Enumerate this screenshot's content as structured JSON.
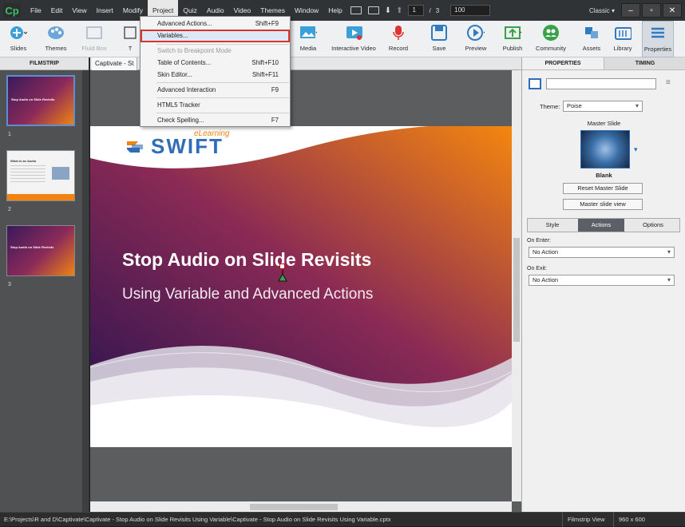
{
  "app": {
    "logo": "Cp",
    "workspace": "Classic"
  },
  "menubar": {
    "items": [
      "File",
      "Edit",
      "View",
      "Insert",
      "Modify",
      "Project",
      "Quiz",
      "Audio",
      "Video",
      "Themes",
      "Window",
      "Help"
    ],
    "active": "Project",
    "page_current": "1",
    "page_sep": "/",
    "page_total": "3",
    "zoom": "100"
  },
  "toolbar": {
    "buttons": [
      {
        "label": "Slides",
        "icon": "add-slide-icon"
      },
      {
        "label": "Themes",
        "icon": "palette-icon"
      },
      {
        "label": "Fluid Box",
        "icon": "fluid-box-icon",
        "disabled": true
      },
      {
        "label": "T",
        "icon": "text-icon"
      },
      {
        "label": "Media",
        "icon": "image-icon"
      },
      {
        "label": "Interactive Video",
        "icon": "interactive-video-icon"
      },
      {
        "label": "Record",
        "icon": "microphone-icon"
      },
      {
        "label": "Save",
        "icon": "save-icon"
      },
      {
        "label": "Preview",
        "icon": "play-icon"
      },
      {
        "label": "Publish",
        "icon": "publish-icon"
      },
      {
        "label": "Community",
        "icon": "community-icon"
      },
      {
        "label": "Assets",
        "icon": "assets-icon"
      },
      {
        "label": "Library",
        "icon": "library-icon"
      },
      {
        "label": "Properties",
        "icon": "properties-icon"
      }
    ]
  },
  "project_menu": {
    "items": [
      {
        "label": "Advanced Actions...",
        "shortcut": "Shift+F9"
      },
      {
        "label": "Variables...",
        "shortcut": "",
        "highlighted": true
      },
      {
        "label": "Switch to Breakpoint Mode",
        "shortcut": "",
        "disabled": true
      },
      {
        "label": "Table of Contents...",
        "shortcut": "Shift+F10"
      },
      {
        "label": "Skin Editor...",
        "shortcut": "Shift+F11"
      },
      {
        "label": "Advanced Interaction",
        "shortcut": "F9"
      },
      {
        "label": "HTML5 Tracker",
        "shortcut": ""
      },
      {
        "label": "Check Spelling...",
        "shortcut": "F7"
      }
    ]
  },
  "filmstrip": {
    "header": "FILMSTRIP",
    "slides": [
      {
        "num": "1",
        "title": "Stop Audio on Slide Revisits"
      },
      {
        "num": "2",
        "title": "What is an Audio"
      },
      {
        "num": "3",
        "title": "Stop Audio on Slide Revisits"
      }
    ]
  },
  "stage": {
    "tab": "Captivate - St",
    "slide_title": "Stop Audio on Slide Revisits",
    "slide_subtitle": "Using Variable and Advanced Actions",
    "logo_text": "SWIFT",
    "logo_tagline": "eLearning"
  },
  "properties": {
    "tabs": [
      "PROPERTIES",
      "TIMING"
    ],
    "theme_label": "Theme:",
    "theme_value": "Poise",
    "master_slide_label": "Master Slide",
    "master_name": "Blank",
    "reset_button": "Reset Master Slide",
    "master_view_button": "Master slide view",
    "segments": [
      "Style",
      "Actions",
      "Options"
    ],
    "active_segment": "Actions",
    "on_enter_label": "On Enter:",
    "on_enter_value": "No Action",
    "on_exit_label": "On Exit:",
    "on_exit_value": "No Action"
  },
  "status": {
    "path": "E:\\Projects\\R and D\\Captivate\\Captivate - Stop Audio on Slide Revisits Using Variable\\Captivate - Stop Audio on Slide Revisits Using Variable.cptx",
    "view": "Filmstrip View",
    "resolution": "960 x 600"
  },
  "colors": {
    "accent": "#3b6fd1",
    "highlight_box": "#d9332c",
    "slide_orange": "#f08312",
    "slide_purple": "#3a1a5b"
  }
}
